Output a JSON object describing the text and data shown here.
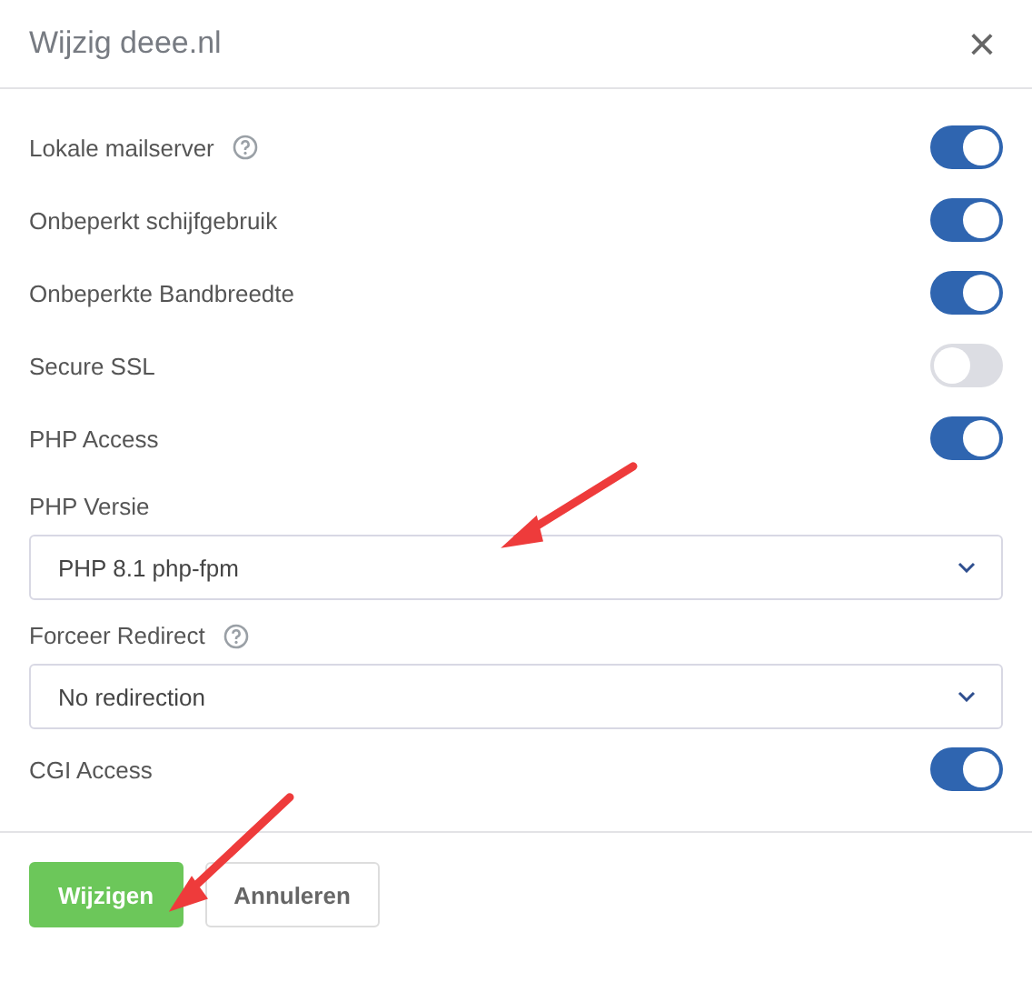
{
  "dialog": {
    "title": "Wijzig deee.nl",
    "close": "×"
  },
  "fields": [
    {
      "kind": "toggle",
      "label": "Lokale mailserver",
      "help": true,
      "on": true
    },
    {
      "kind": "toggle",
      "label": "Onbeperkt schijfgebruik",
      "help": false,
      "on": true
    },
    {
      "kind": "toggle",
      "label": "Onbeperkte Bandbreedte",
      "help": false,
      "on": true
    },
    {
      "kind": "toggle",
      "label": "Secure SSL",
      "help": false,
      "on": false
    },
    {
      "kind": "toggle",
      "label": "PHP Access",
      "help": false,
      "on": true
    },
    {
      "kind": "select",
      "label": "PHP Versie",
      "help": false,
      "value": "PHP 8.1 php-fpm"
    },
    {
      "kind": "select",
      "label": "Forceer Redirect",
      "help": true,
      "value": "No redirection"
    },
    {
      "kind": "toggle",
      "label": "CGI Access",
      "help": false,
      "on": true
    }
  ],
  "buttons": [
    {
      "label": "Wijzigen",
      "kind": "primary"
    },
    {
      "label": "Annuleren",
      "kind": "secondary"
    }
  ]
}
